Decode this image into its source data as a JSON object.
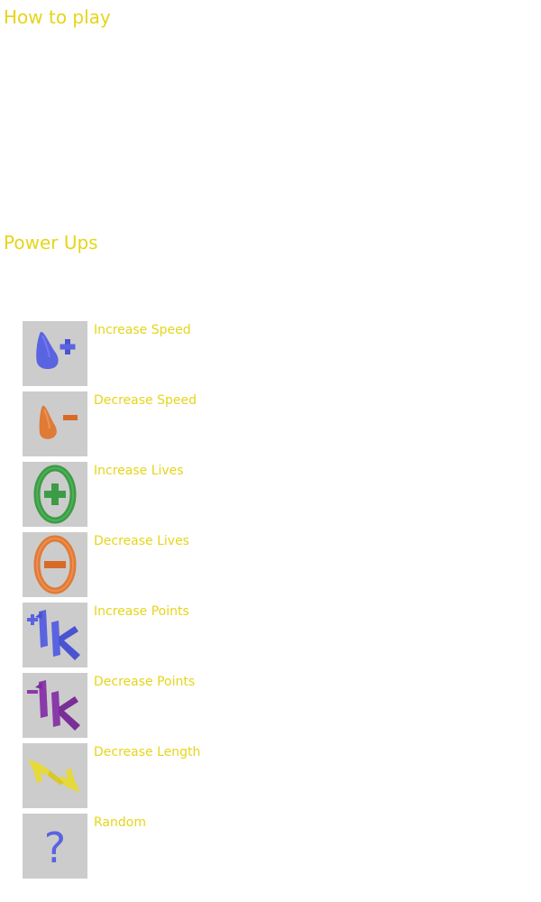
{
  "sections": {
    "how_to_play": "How to play",
    "power_ups": "Power Ups"
  },
  "powerups": [
    {
      "label": "Increase Speed",
      "icon": "blue-speed-plus-icon",
      "color": "#5a63e0"
    },
    {
      "label": "Decrease Speed",
      "icon": "orange-speed-minus-icon",
      "color": "#e07a36"
    },
    {
      "label": "Increase Lives",
      "icon": "green-ring-plus-icon",
      "color": "#3c9c46"
    },
    {
      "label": "Decrease Lives",
      "icon": "orange-ring-minus-icon",
      "color": "#e07a36"
    },
    {
      "label": "Increase Points",
      "icon": "blue-plus-1k-icon",
      "color": "#5a63e0"
    },
    {
      "label": "Decrease Points",
      "icon": "purple-minus-1k-icon",
      "color": "#8a3aa8"
    },
    {
      "label": "Decrease Length",
      "icon": "yellow-arrows-icon",
      "color": "#e6d93a"
    },
    {
      "label": "Random",
      "icon": "question-mark-icon",
      "color": "#5a63e0"
    }
  ],
  "colors": {
    "heading": "#e6d51a",
    "tile_bg": "#cccccc"
  }
}
